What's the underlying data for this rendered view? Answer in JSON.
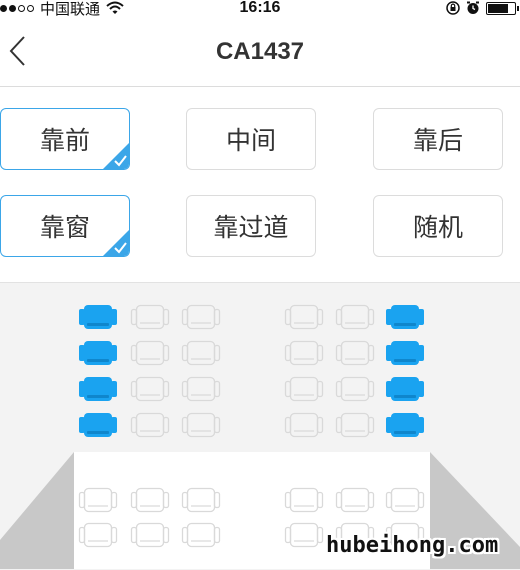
{
  "status_bar": {
    "carrier": "中国联通",
    "time": "16:16",
    "signal_icon": "signal-dots-icon",
    "wifi_icon": "wifi-icon",
    "lock_icon": "orientation-lock-icon",
    "alarm_icon": "alarm-icon",
    "battery_icon": "battery-icon",
    "battery_level": 0.85
  },
  "nav": {
    "back_icon": "chevron-left-icon",
    "title": "CA1437"
  },
  "options": {
    "row1": [
      {
        "label": "靠前",
        "selected": true
      },
      {
        "label": "中间",
        "selected": false
      },
      {
        "label": "靠后",
        "selected": false
      }
    ],
    "row2": [
      {
        "label": "靠窗",
        "selected": true
      },
      {
        "label": "靠过道",
        "selected": false
      },
      {
        "label": "随机",
        "selected": false
      }
    ]
  },
  "seat_map": {
    "highlight_color": "#1aa3f0",
    "available_color": "#d9d9d9",
    "columns": 6,
    "rows_top": [
      [
        "selected",
        "empty",
        "empty",
        "empty",
        "empty",
        "selected"
      ],
      [
        "selected",
        "empty",
        "empty",
        "empty",
        "empty",
        "selected"
      ],
      [
        "selected",
        "empty",
        "empty",
        "empty",
        "empty",
        "selected"
      ],
      [
        "selected",
        "empty",
        "empty",
        "empty",
        "empty",
        "selected"
      ]
    ],
    "rows_bottom": [
      [
        "empty",
        "empty",
        "empty",
        "empty",
        "empty",
        "empty"
      ],
      [
        "empty",
        "empty",
        "empty",
        "empty",
        "empty",
        "empty"
      ]
    ]
  },
  "watermark": "hubeihong.com",
  "colors": {
    "accent": "#3ba6e8",
    "border": "#dcdcdc",
    "seat_area_bg": "#f3f3f3"
  }
}
